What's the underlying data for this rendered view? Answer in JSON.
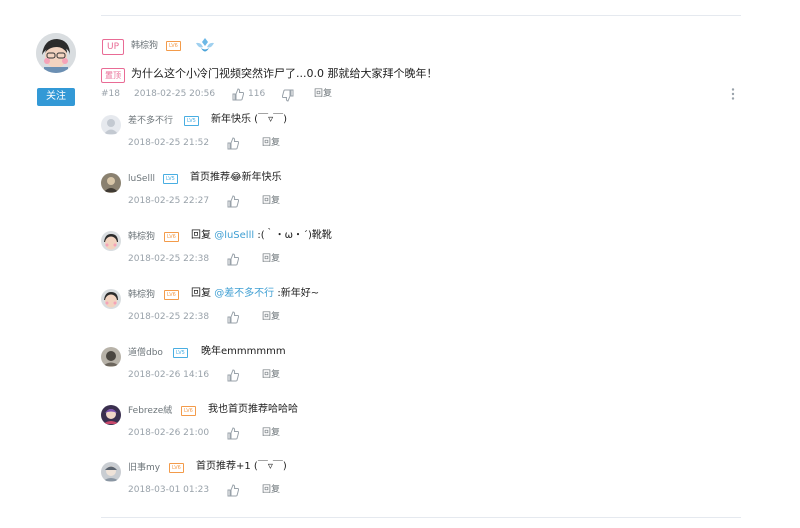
{
  "main": {
    "up_badge": "UP",
    "author": "韩棕狗",
    "level": "LV6",
    "pin_label": "置顶",
    "text": "为什么这个小冷门视频突然诈尸了...0.0 那就给大家拜个晚年！",
    "floor": "#18",
    "time": "2018-02-25 20:56",
    "likes": "116",
    "reply_label": "回复",
    "follow_label": "关注"
  },
  "replies": [
    {
      "author": "差不多不行",
      "level": "LV5",
      "prefix": "",
      "mention": "",
      "text": "新年快乐 (￣▿￣)",
      "time": "2018-02-25 21:52",
      "reply_label": "回复"
    },
    {
      "author": "luSelll",
      "level": "LV5",
      "prefix": "",
      "mention": "",
      "text": "首页推荐😂新年快乐",
      "time": "2018-02-25 22:27",
      "reply_label": "回复"
    },
    {
      "author": "韩棕狗",
      "level": "LV6",
      "prefix": "回复 ",
      "mention": "@luSelll",
      "text": " :(｀・ω・´)靴靴",
      "time": "2018-02-25 22:38",
      "reply_label": "回复"
    },
    {
      "author": "韩棕狗",
      "level": "LV6",
      "prefix": "回复 ",
      "mention": "@差不多不行",
      "text": " :新年好~",
      "time": "2018-02-25 22:38",
      "reply_label": "回复"
    },
    {
      "author": "道僧dbo",
      "level": "LV5",
      "prefix": "",
      "mention": "",
      "text": "晚年emmmmmm",
      "time": "2018-02-26 14:16",
      "reply_label": "回复"
    },
    {
      "author": "Febreze絨",
      "level": "LV6",
      "prefix": "",
      "mention": "",
      "text": "我也首页推荐哈哈哈",
      "time": "2018-02-26 21:00",
      "reply_label": "回复"
    },
    {
      "author": "旧事my",
      "level": "LV6",
      "prefix": "",
      "mention": "",
      "text": "首页推荐+1 (￣▿￣)",
      "time": "2018-03-01 01:23",
      "reply_label": "回复"
    }
  ],
  "colors": {
    "accent": "#3399d6",
    "up_pink": "#e96b95",
    "level_orange": "#f39b4a",
    "level_blue": "#49aee2",
    "mention": "#3f9fd3"
  }
}
